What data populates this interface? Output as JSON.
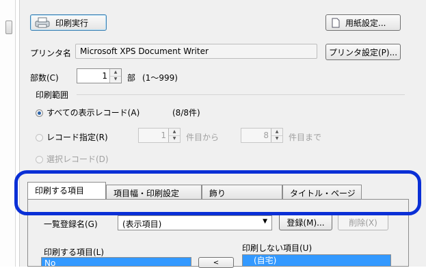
{
  "toolbar": {
    "print_exec": "印刷実行",
    "paper_setup": "用紙設定..."
  },
  "printer": {
    "label": "プリンタ名",
    "name": "Microsoft XPS Document Writer",
    "setup": "プリンタ設定(P)..."
  },
  "copies": {
    "label": "部数(C)",
    "value": "1",
    "unit": "部",
    "range": "(1〜999)"
  },
  "range": {
    "group_title": "印刷範囲",
    "all_records": "すべての表示レコード(A)",
    "all_count": "(8/8件)",
    "specify": "レコード指定(R)",
    "from_value": "1",
    "from_suffix": "件目から",
    "to_value": "8",
    "to_suffix": "件目まで",
    "selected": "選択レコード(D)"
  },
  "tabs": [
    "印刷する項目",
    "項目幅・印刷設定",
    "飾り",
    "タイトル・ページ"
  ],
  "tab_body": {
    "list_name_label": "一覧登録名(G)",
    "list_name_value": "(表示項目)",
    "register": "登録(M)...",
    "delete": "削除(X)",
    "print_items_label": "印刷する項目(L)",
    "print_items_first": "No",
    "no_print_label": "印刷しない項目(U)",
    "no_print_first": "　(自宅)",
    "move_button": "<"
  },
  "colors": {
    "highlight": "#0a2fd6",
    "selection": "#3399ff"
  }
}
